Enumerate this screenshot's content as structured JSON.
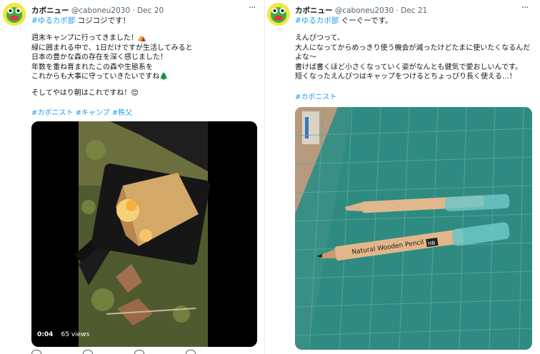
{
  "left_tweet": {
    "display_name": "カボニュー",
    "handle": "@caboneu2030",
    "separator": "·",
    "date": "Dec 20",
    "hashtag": "#ゆるカボ部",
    "after_hashtag": "コジコジです！",
    "body_lines": [
      "週末キャンプに行ってきました！⛺",
      "緑に囲まれる中で、1日だけですが生活してみると",
      "日本の豊かな森の存在を深く感じました！",
      "年数を重ね育まれたこの森や生態系を",
      "これからも大事に守っていきたいですね🌲",
      "",
      "そしてやはり朝はこれですね！😊"
    ],
    "tags": [
      "#カボニスト",
      "#キャンプ",
      "#秩父"
    ],
    "video": {
      "time": "0:04",
      "views": "65 views"
    },
    "more_icon": "more-horizontal-icon"
  },
  "right_tweet": {
    "display_name": "カボニュー",
    "handle": "@caboneu2030",
    "separator": "·",
    "date": "Dec 21",
    "hashtag": "#ゆるカボ部",
    "after_hashtag": "ぐーぐーです。",
    "body_lines": [
      "えんぴつって、",
      "大人になってからめっきり使う機会が減ったけどたまに使いたくなるんだ",
      "よな〜",
      "書けば書くほど小さくなっていく姿がなんとも健気で愛おしいんです。",
      "短くなったえんぴつはキャップをつけるとちょっぴり長く使える…！"
    ],
    "tags": [
      "#カボニスト"
    ],
    "photo_text": {
      "pencil_label": "Natural Wooden Pencil",
      "pencil_grade": "HB"
    },
    "more_icon": "more-horizontal-icon"
  },
  "colors": {
    "link": "#1d9bf0",
    "text": "#0f1419",
    "muted": "#536471",
    "mat": "#2e8a80"
  }
}
